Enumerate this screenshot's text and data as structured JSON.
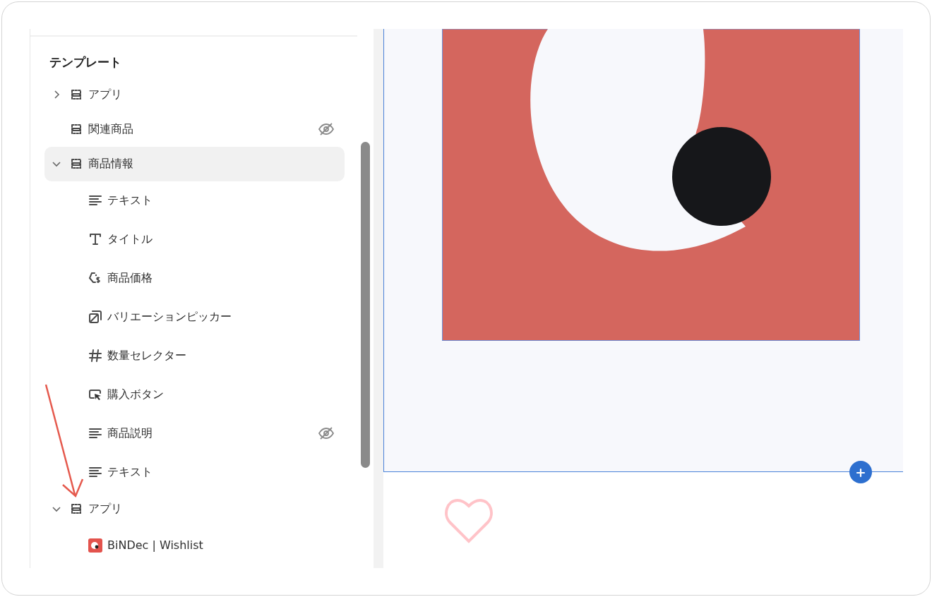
{
  "sidebar": {
    "heading": "テンプレート",
    "items": [
      {
        "label": "アプリ",
        "kind": "section",
        "expandable": true,
        "expanded": false,
        "hidden": false,
        "selected": false
      },
      {
        "label": "関連商品",
        "kind": "section",
        "expandable": false,
        "hidden": true,
        "selected": false
      },
      {
        "label": "商品情報",
        "kind": "section",
        "expandable": true,
        "expanded": true,
        "hidden": false,
        "selected": true,
        "children": [
          {
            "label": "テキスト",
            "kind": "text",
            "hidden": false
          },
          {
            "label": "タイトル",
            "kind": "title",
            "hidden": false
          },
          {
            "label": "商品価格",
            "kind": "price",
            "hidden": false
          },
          {
            "label": "バリエーションピッカー",
            "kind": "variant",
            "hidden": false
          },
          {
            "label": "数量セレクター",
            "kind": "quantity",
            "hidden": false
          },
          {
            "label": "購入ボタン",
            "kind": "buy",
            "hidden": false
          },
          {
            "label": "商品説明",
            "kind": "text",
            "hidden": true
          },
          {
            "label": "テキスト",
            "kind": "text",
            "hidden": false
          }
        ]
      },
      {
        "label": "アプリ",
        "kind": "section",
        "expandable": true,
        "expanded": true,
        "hidden": false,
        "selected": false,
        "children": [
          {
            "label": "BiNDec | Wishlist",
            "kind": "app",
            "hidden": false
          }
        ]
      }
    ]
  }
}
